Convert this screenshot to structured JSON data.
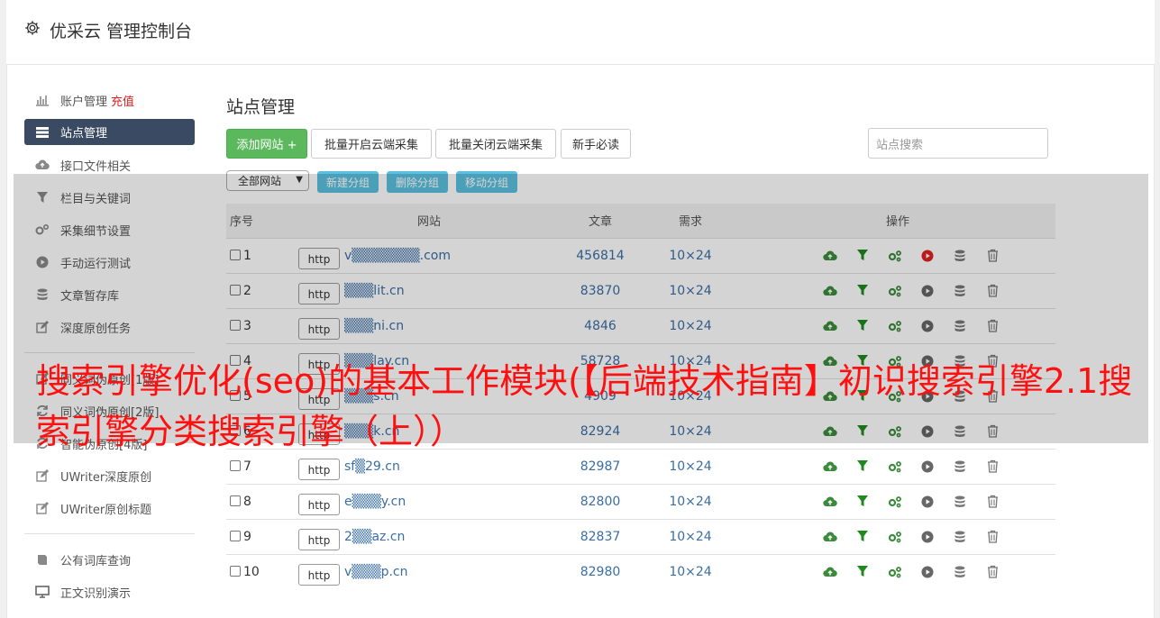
{
  "header": {
    "title": "优采云 管理控制台",
    "icon": "gear-icon"
  },
  "sidebar": {
    "items": [
      {
        "label": "账户管理",
        "extra": "充值",
        "icon": "bar-chart-icon"
      },
      {
        "label": "站点管理",
        "icon": "server-icon",
        "active": true
      },
      {
        "label": "接口文件相关",
        "icon": "cloud-upload-icon"
      },
      {
        "label": "栏目与关键词",
        "icon": "filter-icon"
      },
      {
        "label": "采集细节设置",
        "icon": "gears-icon"
      },
      {
        "label": "手动运行测试",
        "icon": "play-icon"
      },
      {
        "label": "文章暂存库",
        "icon": "database-icon"
      },
      {
        "label": "深度原创任务",
        "icon": "edit-icon"
      }
    ],
    "items2": [
      {
        "label": "同义词伪原创[1版]",
        "icon": "edit-icon"
      },
      {
        "label": "同义词伪原创[2版]",
        "icon": "refresh-icon"
      },
      {
        "label": "智能伪原创[4版]",
        "icon": "refresh-icon"
      },
      {
        "label": "UWriter深度原创",
        "icon": "edit-icon"
      },
      {
        "label": "UWriter原创标题",
        "icon": "edit-icon"
      }
    ],
    "items3": [
      {
        "label": "公有词库查询",
        "icon": "book-icon"
      },
      {
        "label": "正文识别演示",
        "icon": "monitor-icon"
      }
    ]
  },
  "main": {
    "title": "站点管理",
    "buttons": {
      "add": "添加网站 +",
      "batch_open": "批量开启云端采集",
      "batch_close": "批量关闭云端采集",
      "guide": "新手必读"
    },
    "search_placeholder": "站点搜索",
    "group_select": "全部网站",
    "group_buttons": {
      "new": "新建分组",
      "delete": "删除分组",
      "move": "移动分组"
    },
    "table": {
      "headers": {
        "no": "序号",
        "site": "网站",
        "articles": "文章",
        "demand": "需求",
        "ops": "操作"
      },
      "rows": [
        {
          "no": "1",
          "proto": "http",
          "domain": "v▒▒▒▒▒▒▒.com",
          "articles": "456814",
          "demand": "10×24"
        },
        {
          "no": "2",
          "proto": "http",
          "domain": "▒▒▒lit.cn",
          "articles": "83870",
          "demand": "10×24"
        },
        {
          "no": "3",
          "proto": "http",
          "domain": "▒▒▒ni.cn",
          "articles": "4846",
          "demand": "10×24"
        },
        {
          "no": "4",
          "proto": "http",
          "domain": "▒▒▒lay.cn",
          "articles": "58728",
          "demand": "10×24"
        },
        {
          "no": "5",
          "proto": "http",
          "domain": "▒▒▒s.cn",
          "articles": "4909",
          "demand": "10×24"
        },
        {
          "no": "6",
          "proto": "http",
          "domain": "▒▒▒k.cn",
          "articles": "82924",
          "demand": "10×24"
        },
        {
          "no": "7",
          "proto": "http",
          "domain": "sf▒29.cn",
          "articles": "82987",
          "demand": "10×24"
        },
        {
          "no": "8",
          "proto": "http",
          "domain": "e▒▒▒y.cn",
          "articles": "82800",
          "demand": "10×24"
        },
        {
          "no": "9",
          "proto": "http",
          "domain": "2▒▒az.cn",
          "articles": "82837",
          "demand": "10×24"
        },
        {
          "no": "10",
          "proto": "http",
          "domain": "v▒▒▒p.cn",
          "articles": "82980",
          "demand": "10×24"
        }
      ]
    }
  },
  "overlay": {
    "headline": "搜索引擎优化(seo)的基本工作模块(【后端技术指南】初识搜索引擎2.1搜索引擎分类搜索引擎（上））"
  },
  "colors": {
    "accent": "#3b4a63",
    "green": "#5cb85c",
    "headline": "#ff1010",
    "link": "#3a6ea5"
  }
}
